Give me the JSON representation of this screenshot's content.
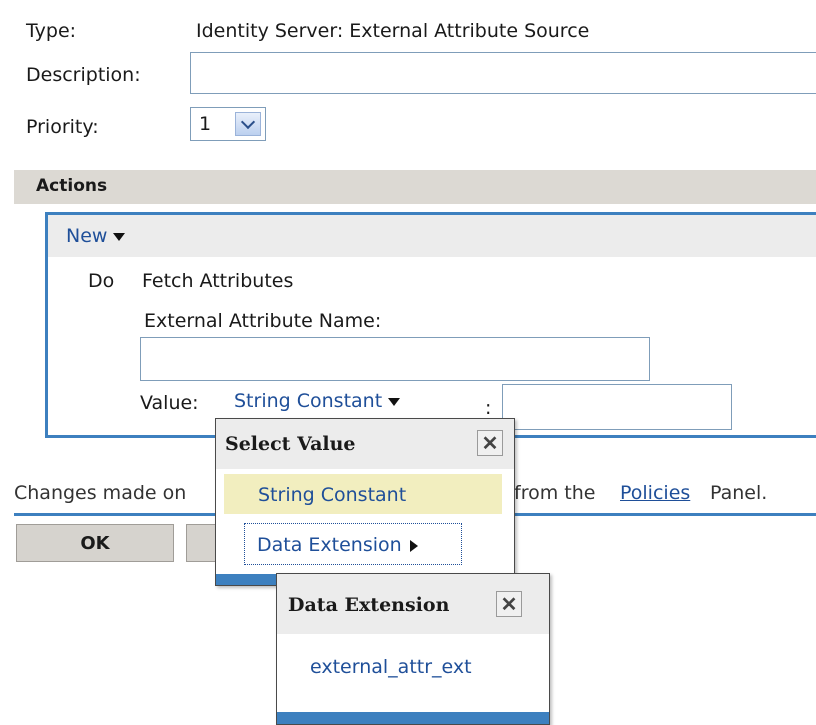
{
  "form": {
    "type_label": "Type:",
    "type_value": "Identity Server: External Attribute Source",
    "description_label": "Description:",
    "description_value": "",
    "priority_label": "Priority:",
    "priority_value": "1"
  },
  "actions": {
    "header": "Actions",
    "new_label": "New",
    "do_label": "Do",
    "action_name": "Fetch Attributes",
    "ext_attr_label": "External Attribute Name:",
    "ext_attr_value": "",
    "value_label": "Value:",
    "value_type": "String Constant",
    "colon": ":",
    "value_input": ""
  },
  "notice": {
    "prefix": "Changes made on",
    "middle": "from the",
    "link": "Policies",
    "suffix": "Panel."
  },
  "buttons": {
    "ok": "OK"
  },
  "select_value_popup": {
    "title": "Select Value",
    "close": "✕",
    "items": [
      "String Constant",
      "Data Extension"
    ]
  },
  "data_extension_popup": {
    "title": "Data Extension",
    "close": "✕",
    "items": [
      "external_attr_ext"
    ]
  },
  "colors": {
    "accent": "#3d80bf",
    "link": "#1f4f99",
    "highlight": "#f2eebf"
  }
}
